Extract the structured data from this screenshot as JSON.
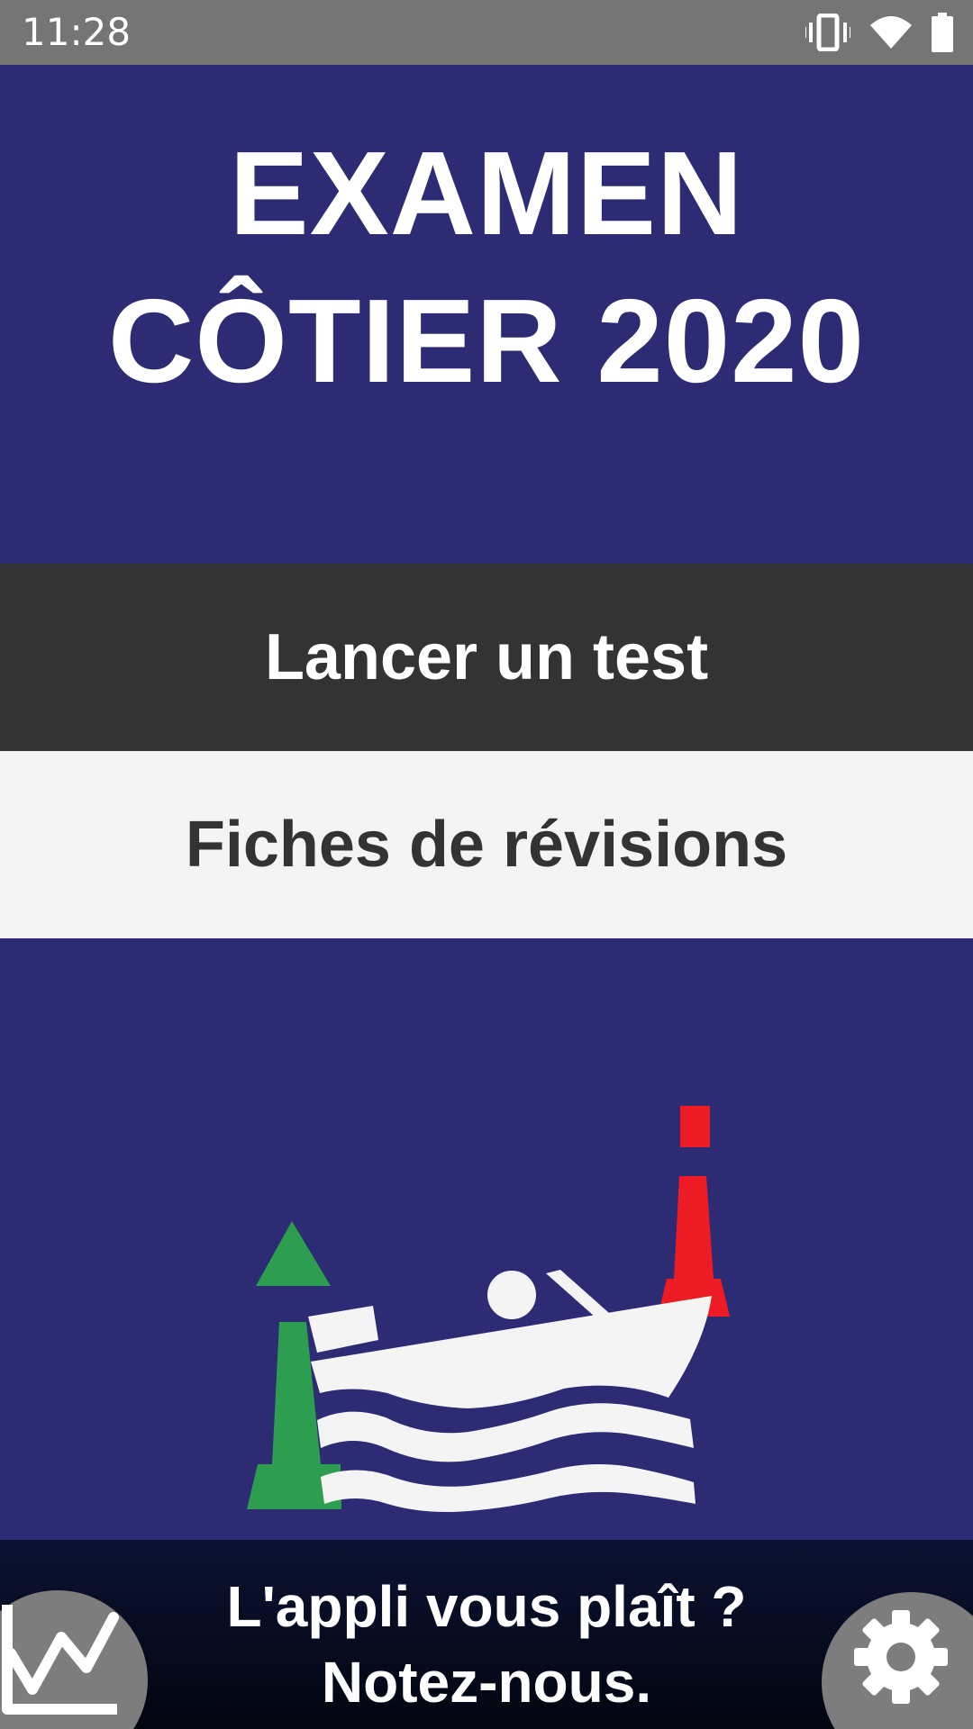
{
  "status_bar": {
    "time": "11:28",
    "icons": [
      "vibrate-icon",
      "wifi-icon",
      "battery-icon"
    ]
  },
  "header": {
    "title_line1": "EXAMEN",
    "title_line2": "CÔTIER 2020"
  },
  "menu": {
    "test_label": "Lancer un test",
    "fiches_label": "Fiches de révisions"
  },
  "illustration": {
    "icon": "boat-between-buoys-illustration"
  },
  "footer": {
    "line1": "L'appli vous plaît ?",
    "line2": "Notez-nous.",
    "left_icon": "stats-chart-icon",
    "right_icon": "settings-gear-icon"
  },
  "colors": {
    "primary": "#2c2b74",
    "dark_button": "#333333",
    "light_button": "#f4f4f4",
    "buoy_green": "#2d9e4f",
    "buoy_red": "#ed1c24",
    "status_bar": "#757575"
  }
}
